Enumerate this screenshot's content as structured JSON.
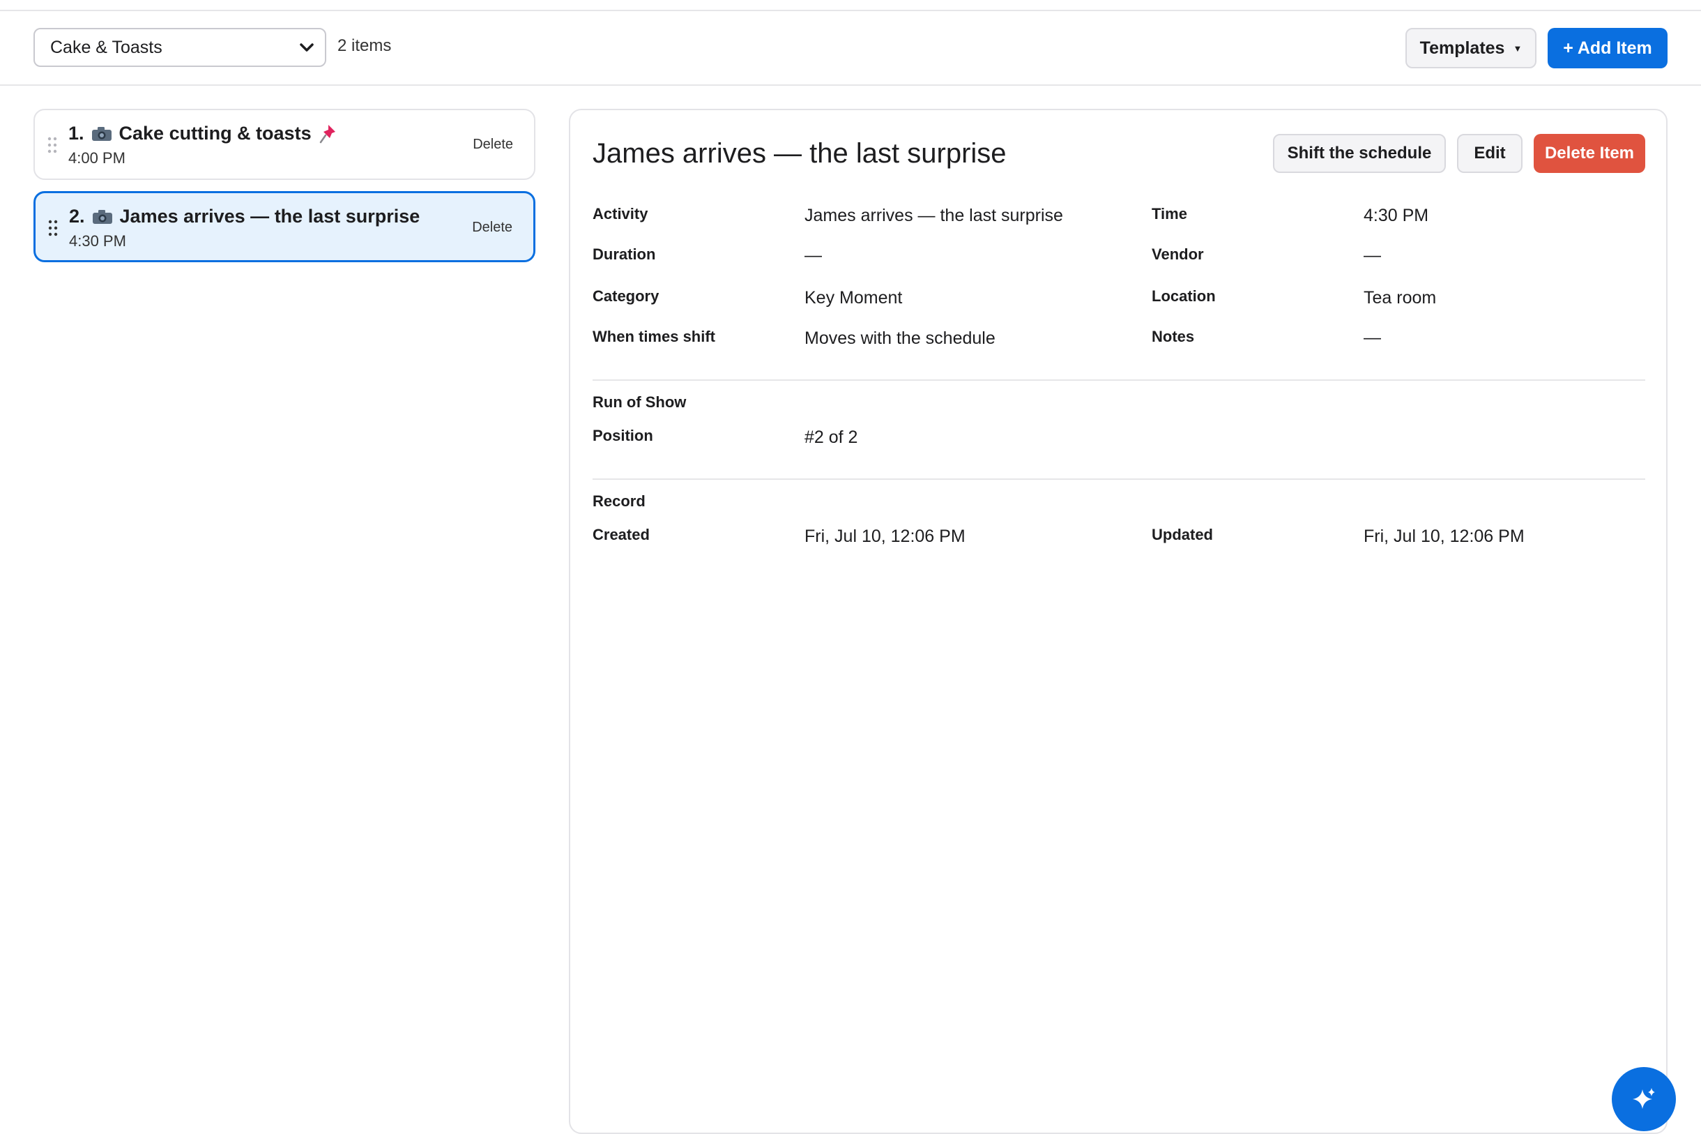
{
  "toolbar": {
    "list_select_value": "Cake & Toasts",
    "item_count": "2 items",
    "templates_label": "Templates",
    "add_item_label": "+ Add Item"
  },
  "sidebar": {
    "items": [
      {
        "number": "1.",
        "title": "Cake cutting & toasts",
        "time": "4:00 PM",
        "delete_label": "Delete",
        "pinned": true,
        "selected": false
      },
      {
        "number": "2.",
        "title": "James arrives — the last surprise",
        "time": "4:30 PM",
        "delete_label": "Delete",
        "pinned": false,
        "selected": true
      }
    ]
  },
  "detail": {
    "title": "James arrives — the last surprise",
    "actions": {
      "shift": "Shift the schedule",
      "edit": "Edit",
      "delete": "Delete Item"
    },
    "fields": {
      "activity_label": "Activity",
      "activity_value": "James arrives — the last surprise",
      "time_label": "Time",
      "time_value": "4:30 PM",
      "duration_label": "Duration",
      "duration_value": "—",
      "vendor_label": "Vendor",
      "vendor_value": "—",
      "category_label": "Category",
      "category_value": "Key Moment",
      "location_label": "Location",
      "location_value": "Tea room",
      "shift_label": "When times shift",
      "shift_value": "Moves with the schedule",
      "notes_label": "Notes",
      "notes_value": "—"
    },
    "run_of_show": {
      "heading": "Run of Show",
      "position_label": "Position",
      "position_value": "#2 of 2"
    },
    "record": {
      "heading": "Record",
      "created_label": "Created",
      "created_value": "Fri, Jul 10, 12:06 PM",
      "updated_label": "Updated",
      "updated_value": "Fri, Jul 10, 12:06 PM"
    }
  },
  "colors": {
    "accent": "#0a6fe0",
    "danger": "#e0533f",
    "selected_bg": "#e6f2fd"
  },
  "icons": [
    "chevron-down-icon",
    "caret-down-icon",
    "drag-handle-icon",
    "camera-icon",
    "pin-icon",
    "sparkle-icon"
  ]
}
